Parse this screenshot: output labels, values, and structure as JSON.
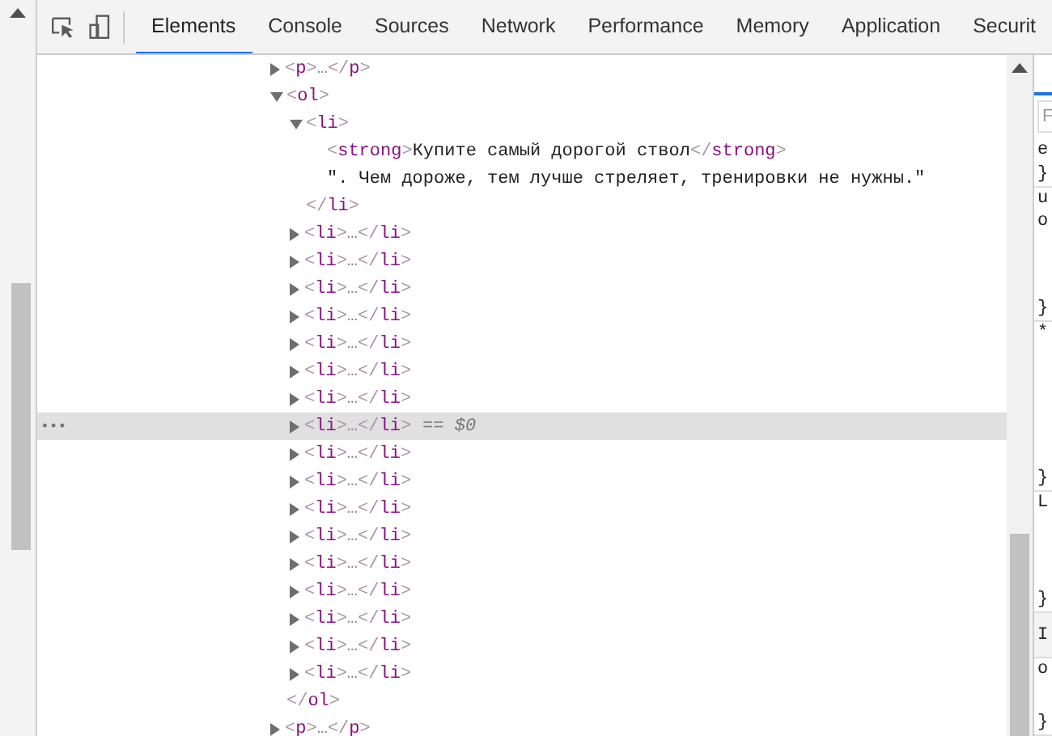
{
  "toolbar": {
    "tabs": [
      {
        "label": "Elements",
        "selected": true
      },
      {
        "label": "Console",
        "selected": false
      },
      {
        "label": "Sources",
        "selected": false
      },
      {
        "label": "Network",
        "selected": false
      },
      {
        "label": "Performance",
        "selected": false
      },
      {
        "label": "Memory",
        "selected": false
      },
      {
        "label": "Application",
        "selected": false
      },
      {
        "label": "Securit",
        "selected": false
      }
    ]
  },
  "dom_tree": {
    "selected_gutter": "•••",
    "selected_suffix": "== $0",
    "nodes": [
      {
        "kind": "collapsed",
        "label": "<p>…</p>",
        "selected": false
      },
      {
        "kind": "expanded",
        "open": "<ol>",
        "close": "</ol>",
        "children": [
          {
            "kind": "expanded",
            "open": "<li>",
            "close": "</li>",
            "children": [
              {
                "kind": "element",
                "open": "<strong>",
                "text": "Купите самый дорогой ствол",
                "close": "</strong>"
              },
              {
                "kind": "text",
                "text": "\". Чем дороже, тем лучше стреляет, тренировки не нужны.\""
              }
            ]
          },
          {
            "kind": "collapsed",
            "label": "<li>…</li>",
            "selected": false
          },
          {
            "kind": "collapsed",
            "label": "<li>…</li>",
            "selected": false
          },
          {
            "kind": "collapsed",
            "label": "<li>…</li>",
            "selected": false
          },
          {
            "kind": "collapsed",
            "label": "<li>…</li>",
            "selected": false
          },
          {
            "kind": "collapsed",
            "label": "<li>…</li>",
            "selected": false
          },
          {
            "kind": "collapsed",
            "label": "<li>…</li>",
            "selected": false
          },
          {
            "kind": "collapsed",
            "label": "<li>…</li>",
            "selected": false
          },
          {
            "kind": "collapsed",
            "label": "<li>…</li>",
            "selected": true
          },
          {
            "kind": "collapsed",
            "label": "<li>…</li>",
            "selected": false
          },
          {
            "kind": "collapsed",
            "label": "<li>…</li>",
            "selected": false
          },
          {
            "kind": "collapsed",
            "label": "<li>…</li>",
            "selected": false
          },
          {
            "kind": "collapsed",
            "label": "<li>…</li>",
            "selected": false
          },
          {
            "kind": "collapsed",
            "label": "<li>…</li>",
            "selected": false
          },
          {
            "kind": "collapsed",
            "label": "<li>…</li>",
            "selected": false
          },
          {
            "kind": "collapsed",
            "label": "<li>…</li>",
            "selected": false
          },
          {
            "kind": "collapsed",
            "label": "<li>…</li>",
            "selected": false
          },
          {
            "kind": "collapsed",
            "label": "<li>…</li>",
            "selected": false
          }
        ]
      },
      {
        "kind": "collapsed",
        "label": "<p>…</p>",
        "selected": false
      }
    ]
  },
  "side_panel": {
    "filter_placeholder": "F",
    "rules": [
      {
        "lines": [
          "e",
          "}"
        ]
      },
      {
        "lines": [
          "u",
          "o",
          "}"
        ]
      },
      {
        "lines": [
          "*",
          "}"
        ]
      },
      {
        "lines": [
          "L",
          "}"
        ]
      },
      {
        "lines": [
          "I"
        ]
      },
      {
        "lines": [
          "o",
          "}"
        ]
      }
    ]
  }
}
